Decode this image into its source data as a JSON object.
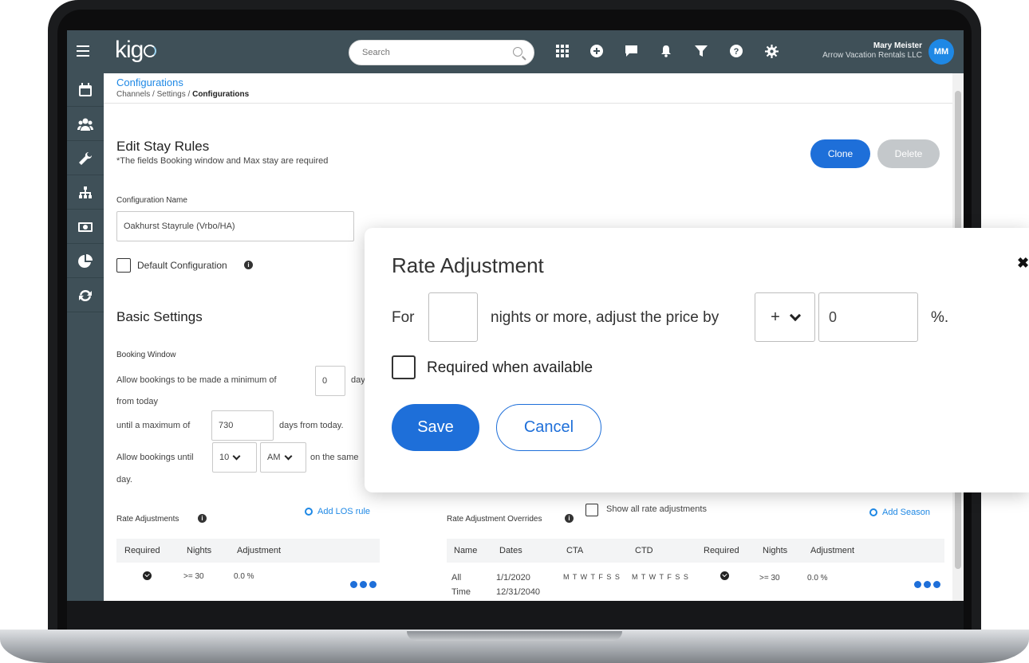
{
  "app": {
    "logo": "kig",
    "search_placeholder": "Search",
    "user_name": "Mary Meister",
    "user_org": "Arrow Vacation Rentals LLC",
    "user_initials": "MM"
  },
  "topbar_icons": [
    "apps-grid-icon",
    "add-circle-icon",
    "chat-icon",
    "bell-icon",
    "filter-icon",
    "help-icon",
    "settings-gear-icon"
  ],
  "sidebar_icons": [
    "calendar-icon",
    "users-icon",
    "wrench-icon",
    "org-chart-icon",
    "money-icon",
    "pie-chart-icon",
    "sync-icon"
  ],
  "page": {
    "title_link": "Configurations",
    "breadcrumb": [
      "Channels",
      "Settings",
      "Configurations"
    ],
    "separator": "/",
    "heading": "Edit Stay Rules",
    "note": "*The fields Booking window and Max stay are required",
    "clone_label": "Clone",
    "delete_label": "Delete"
  },
  "config": {
    "name_label": "Configuration Name",
    "name_value": "Oakhurst Stayrule (Vrbo/HA)",
    "default_label": "Default Configuration",
    "info_glyph": "i"
  },
  "basic": {
    "heading": "Basic Settings",
    "booking_window_label": "Booking Window",
    "min_text": "Allow bookings to be made a minimum of",
    "min_value": "0",
    "min_suffix": "day",
    "from_today": "from today",
    "max_text": "until a maximum of",
    "max_value": "730",
    "max_suffix": "days from today.",
    "until_text": "Allow bookings until",
    "hour_value": "10",
    "ampm_value": "AM",
    "until_suffix": "on the same",
    "day_text": "day."
  },
  "rate_adjustments": {
    "label": "Rate Adjustments",
    "add_link": "Add LOS rule",
    "columns": [
      "Required",
      "Nights",
      "Adjustment"
    ],
    "rows": [
      {
        "nights": ">= 30",
        "adjustment": "0.0 %"
      }
    ]
  },
  "overrides": {
    "label": "Rate Adjustment Overrides",
    "show_all_label": "Show all rate adjustments",
    "add_link": "Add Season",
    "columns": [
      "Name",
      "Dates",
      "CTA",
      "CTD",
      "Required",
      "Nights",
      "Adjustment"
    ],
    "rows": [
      {
        "name_1": "All",
        "name_2": "Time",
        "date_1": "1/1/2020",
        "date_2": "12/31/2040",
        "cta": "M T W T F S S",
        "ctd": "M T W T F S S",
        "nights": ">= 30",
        "adjustment": "0.0 %"
      }
    ]
  },
  "modal": {
    "title": "Rate Adjustment",
    "close_glyph": "✖",
    "for_text": "For",
    "nights_value": "",
    "middle_text": "nights or more, adjust the price by",
    "sign_value": "+",
    "percent_value": "0",
    "percent_suffix": "%.",
    "required_label": "Required when available",
    "save_label": "Save",
    "cancel_label": "Cancel"
  },
  "colors": {
    "topbar": "#3f5058",
    "primary": "#1e6fd9",
    "link": "#1e88e5",
    "disabled": "#c4c8cb"
  }
}
